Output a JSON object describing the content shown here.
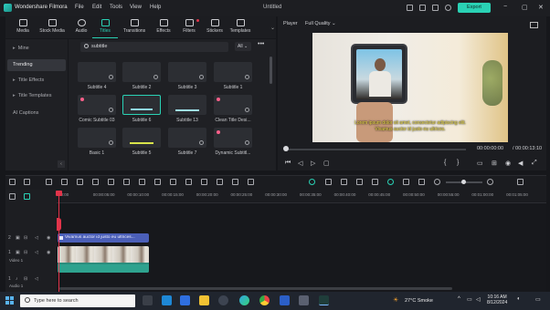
{
  "app": {
    "name": "Wondershare Filmora",
    "document": "Untitled",
    "export_label": "Export"
  },
  "menu": [
    "File",
    "Edit",
    "Tools",
    "View",
    "Help"
  ],
  "toolbar": {
    "items": [
      {
        "label": "Media",
        "icon": "media-icon"
      },
      {
        "label": "Stock Media",
        "icon": "stock-media-icon"
      },
      {
        "label": "Audio",
        "icon": "music-note-icon"
      },
      {
        "label": "Titles",
        "icon": "text-t-icon"
      },
      {
        "label": "Transitions",
        "icon": "transitions-icon"
      },
      {
        "label": "Effects",
        "icon": "effects-sparkle-icon"
      },
      {
        "label": "Filters",
        "icon": "filters-icon"
      },
      {
        "label": "Stickers",
        "icon": "stickers-icon"
      },
      {
        "label": "Templates",
        "icon": "templates-icon"
      }
    ],
    "active": "Titles"
  },
  "sidebar": {
    "items": [
      {
        "label": "Mine",
        "arrow": "▸"
      },
      {
        "label": "Trending",
        "arrow": ""
      },
      {
        "label": "Title Effects",
        "arrow": "▸"
      },
      {
        "label": "Title Templates",
        "arrow": "▸"
      },
      {
        "label": "AI Captions",
        "arrow": ""
      }
    ],
    "selected": "Trending"
  },
  "assets": {
    "search_value": "subtitle",
    "filter_value": "All",
    "grid": [
      {
        "label": "Subtitle 4"
      },
      {
        "label": "Subtitle 2"
      },
      {
        "label": "Subtitle 3"
      },
      {
        "label": "Subtitle 1"
      },
      {
        "label": "Comic Subtitle 03"
      },
      {
        "label": "Subtitle 6"
      },
      {
        "label": "Subtitle 13"
      },
      {
        "label": "Clean Title Desi..."
      },
      {
        "label": "Basic 1"
      },
      {
        "label": "Subtitle 5"
      },
      {
        "label": "Subtitle 7"
      },
      {
        "label": "Dynamic Subtitl..."
      }
    ]
  },
  "player": {
    "label": "Player",
    "quality": "Full Quality",
    "subtitle_line1": "Lorem ipsum dolor sit amet, consectetur adipiscing elit.",
    "subtitle_line2": "Vivamus auctor id justo eu ultrices.",
    "current_time": "00:00:00:00",
    "total_time": "/ 00:00:13:10"
  },
  "timeline": {
    "ticks": [
      "00:00",
      "00:00:05:00",
      "00:00:10:00",
      "00:00:15:00",
      "00:00:20:00",
      "00:00:25:00",
      "00:00:30:00",
      "00:00:35:00",
      "00:00:40:00",
      "00:00:45:00",
      "00:00:50:00",
      "00:00:55:00",
      "00:01:00:00",
      "00:01:05:00"
    ],
    "title_clip": "Vivamus auctor id justo eu ultrices...",
    "track_labels": {
      "t2": "2",
      "video": "Video 1",
      "audio": "Audio 1",
      "v1": "1",
      "a1": "1"
    }
  },
  "taskbar": {
    "search_placeholder": "Type here to search",
    "weather": "27°C  Smoke",
    "time": "10:16 AM",
    "date": "8/12/2024"
  }
}
